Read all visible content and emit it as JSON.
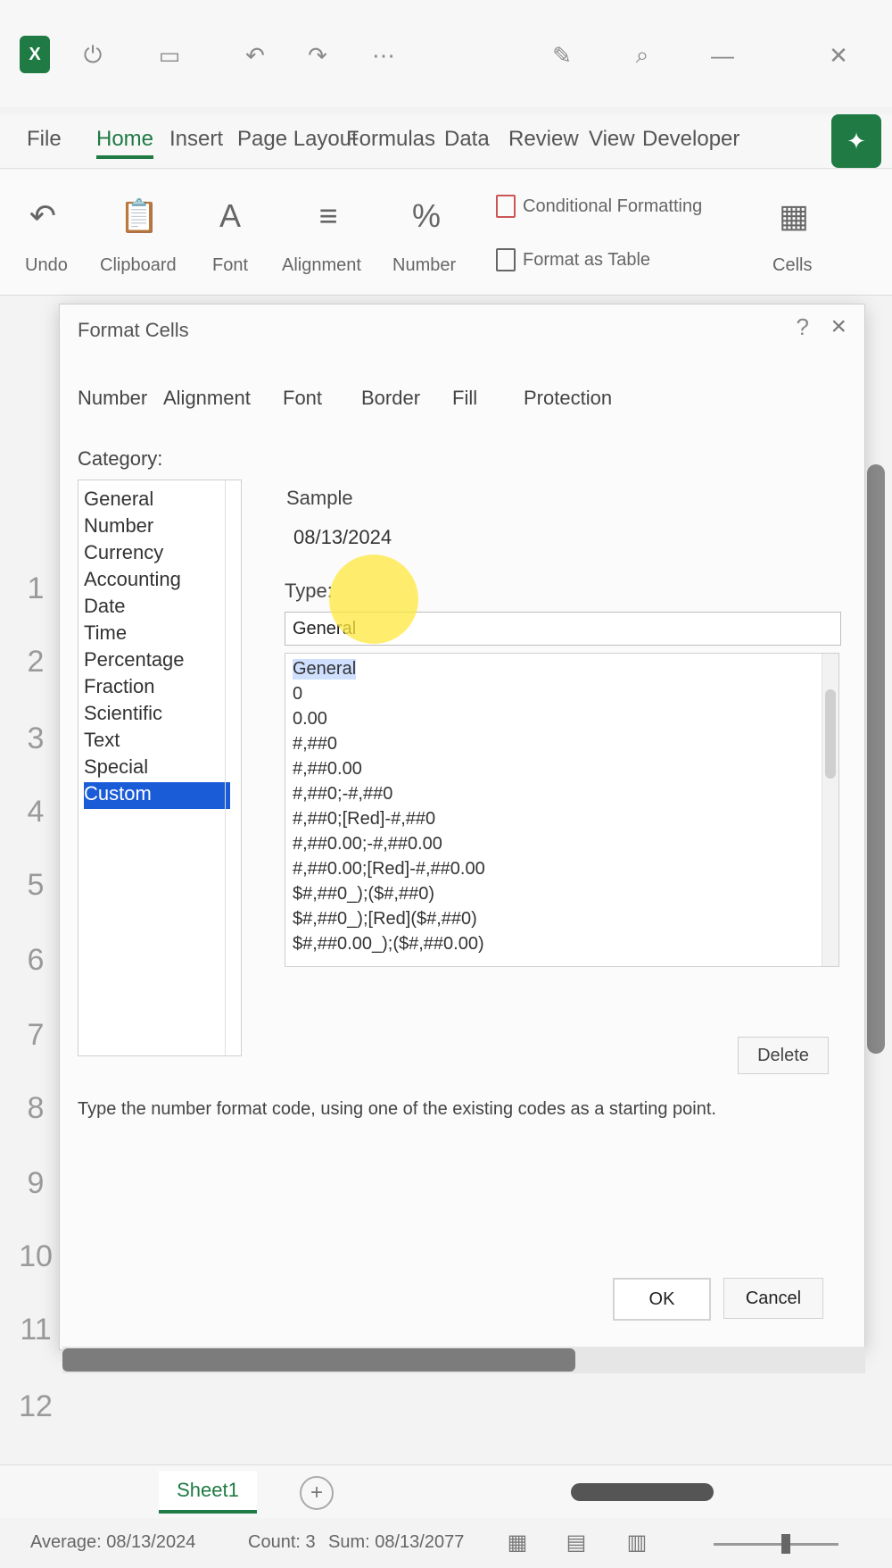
{
  "titlebar": {
    "icons": [
      "excel-logo",
      "autosave-icon",
      "save-icon",
      "undo-icon",
      "redo-icon",
      "pen-icon",
      "search-icon",
      "minimize-icon",
      "close-icon"
    ]
  },
  "ribbon": {
    "tabs": [
      "File",
      "Home",
      "Insert",
      "Page Layout",
      "Formulas",
      "Data",
      "Review",
      "View",
      "Developer"
    ],
    "groups": [
      "Undo",
      "Clipboard",
      "Font",
      "Alignment",
      "Number",
      "Cells"
    ],
    "styles_cmds": [
      "Conditional Formatting",
      "Format as Table"
    ]
  },
  "rows": [
    "1",
    "2",
    "3",
    "4",
    "5",
    "6",
    "7",
    "8",
    "9",
    "10",
    "11",
    "12"
  ],
  "dialog": {
    "title": "Format Cells",
    "help": "?",
    "close": "×",
    "tabs": [
      "Number",
      "Alignment",
      "Font",
      "Border",
      "Fill",
      "Protection"
    ],
    "category_label": "Category:",
    "categories": [
      "General",
      "Number",
      "Currency",
      "Accounting",
      "Date",
      "Time",
      "Percentage",
      "Fraction",
      "Scientific",
      "Text",
      "Special",
      "Custom"
    ],
    "selected_category": "Custom",
    "sample_label": "Sample",
    "sample_value": "08/13/2024",
    "type_label": "Type:",
    "type_value": "General",
    "formats": [
      "General",
      "0",
      "0.00",
      "#,##0",
      "#,##0.00",
      "#,##0;-#,##0",
      "#,##0;[Red]-#,##0",
      "#,##0.00;-#,##0.00",
      "#,##0.00;[Red]-#,##0.00",
      "$#,##0_);($#,##0)",
      "$#,##0_);[Red]($#,##0)",
      "$#,##0.00_);($#,##0.00)"
    ],
    "delete_label": "Delete",
    "description": "Type the number format code, using one of the existing codes as a starting point.",
    "ok_label": "OK",
    "cancel_label": "Cancel"
  },
  "sheets": {
    "active": "Sheet1",
    "add": "+"
  },
  "status": {
    "average": "Average: 08/13/2024",
    "count": "Count: 3",
    "sum": "Sum: 08/13/2077"
  }
}
